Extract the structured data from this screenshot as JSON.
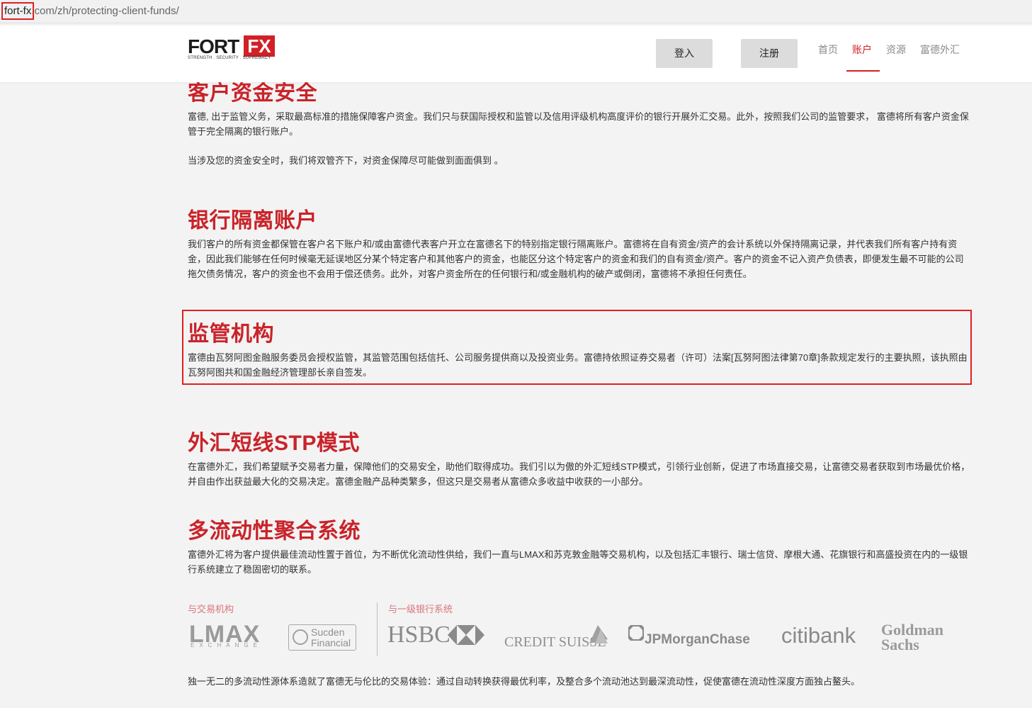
{
  "browser": {
    "url_host": "fort-fx",
    "url_path": ".com/zh/protecting-client-funds/"
  },
  "header": {
    "logo": {
      "main": "FORT",
      "accent": "FX",
      "tagline": "STRENGTH . SECURITY . SUPREMACY"
    },
    "login_label": "登入",
    "register_label": "注册",
    "nav": {
      "home": "首页",
      "account": "账户",
      "resources": "资源",
      "fortfx": "富德外汇"
    }
  },
  "sections": {
    "client_funds": {
      "title": "客户资金安全",
      "p1": "富德, 出于监管义务，采取最高标准的措施保障客户资金。我们只与获国际授权和监管以及信用评级机构高度评价的银行开展外汇交易。此外，按照我们公司的监管要求， 富德将所有客户资金保管于完全隔离的银行账户。",
      "p2": "当涉及您的资金安全时，我们将双管齐下，对资金保障尽可能做到面面俱到 。"
    },
    "segregated": {
      "title": "银行隔离账户",
      "p": "我们客户的所有资金都保管在客户名下账户和/或由富德代表客户开立在富德名下的特别指定银行隔离账户。富德将在自有资金/资产的会计系统以外保持隔离记录，并代表我们所有客户持有资金，因此我们能够在任何时候毫无延误地区分某个特定客户和其他客户的资金，也能区分这个特定客户的资金和我们的自有资金/资产。客户的资金不记入资产负债表，即便发生最不可能的公司拖欠债务情况，客户的资金也不会用于偿还债务。此外，对客户资金所在的任何银行和/或金融机构的破产或倒闭，富德将不承担任何责任。"
    },
    "regulator": {
      "title": "监管机构",
      "p": "富德由瓦努阿图金融服务委员会授权监管，其监管范围包括信托、公司服务提供商以及投资业务。富德持依照证券交易者（许可）法案[瓦努阿图法律第70章]条款规定发行的主要执照，该执照由瓦努阿图共和国金融经济管理部长亲自签发。"
    },
    "stp": {
      "title": "外汇短线STP模式",
      "p": "在富德外汇，我们希望赋予交易者力量，保障他们的交易安全，助他们取得成功。我们引以为傲的外汇短线STP模式，引领行业创新，促进了市场直接交易，让富德交易者获取到市场最优价格，并自由作出获益最大化的交易决定。富德金融产品种类繁多，但这只是交易者从富德众多收益中收获的一小部分。"
    },
    "liquidity": {
      "title": "多流动性聚合系统",
      "p": "富德外汇将为客户提供最佳流动性置于首位，为不断优化流动性供给，我们一直与LMAX和苏克敦金融等交易机构，以及包括汇丰银行、瑞士信贷、摩根大通、花旗银行和高盛投资在内的一级银行系统建立了稳固密切的联系。",
      "exchanges_label": "与交易机构",
      "banks_label": "与一级银行系统",
      "partners": {
        "lmax": "LMAX",
        "lmax_sub": "EXCHANGE",
        "sucden_1": "Sucden",
        "sucden_2": "Financial",
        "hsbc": "HSBC",
        "credit_suisse": "CREDIT SUISSE",
        "jpmorgan": "JPMorganChase",
        "citibank": "citibank",
        "goldman_1": "Goldman",
        "goldman_2": "Sachs"
      },
      "footer": "独一无二的多流动性源体系造就了富德无与伦比的交易体验：通过自动转换获得最优利率，及整合多个流动池达到最深流动性，促使富德在流动性深度方面独占鳌头。"
    }
  },
  "colors": {
    "accent": "#c9232a",
    "highlight_border": "#e02020",
    "background": "#f3f3f3"
  }
}
